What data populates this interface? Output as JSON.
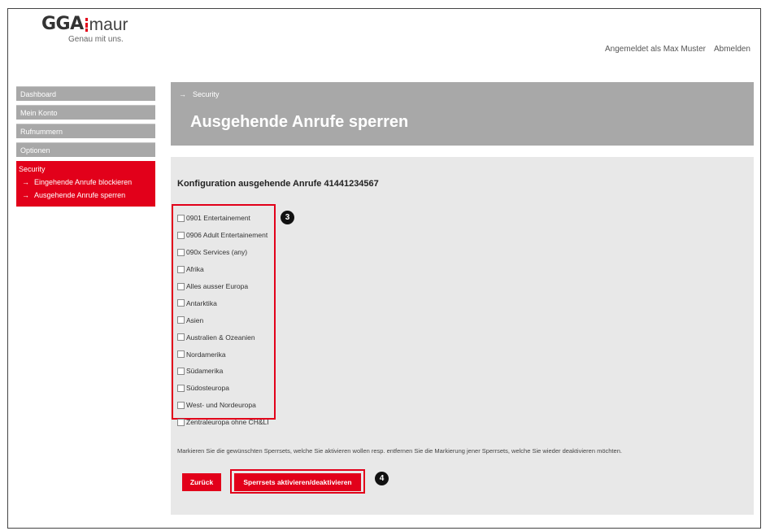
{
  "brand": {
    "logo_main": "GGA",
    "logo_sub": "maur",
    "tagline": "Genau mit uns."
  },
  "header": {
    "logged_in": "Angemeldet als Max Muster",
    "logout": "Abmelden"
  },
  "sidebar": {
    "items": [
      {
        "label": "Dashboard"
      },
      {
        "label": "Mein Konto"
      },
      {
        "label": "Rufnummern"
      },
      {
        "label": "Optionen"
      }
    ],
    "security": {
      "label": "Security",
      "subitems": [
        {
          "label": "Eingehende Anrufe blockieren"
        },
        {
          "label": "Ausgehende Anrufe sperren"
        }
      ]
    }
  },
  "main": {
    "breadcrumb": "Security",
    "title": "Ausgehende Anrufe sperren",
    "config_title": "Konfiguration ausgehende Anrufe 41441234567",
    "options": [
      {
        "label": "0901 Entertainement",
        "checked": false
      },
      {
        "label": "0906 Adult Entertainement",
        "checked": false
      },
      {
        "label": "090x Services (any)",
        "checked": false
      },
      {
        "label": "Afrika",
        "checked": false
      },
      {
        "label": "Alles ausser Europa",
        "checked": false
      },
      {
        "label": "Antarktika",
        "checked": false
      },
      {
        "label": "Asien",
        "checked": false
      },
      {
        "label": "Australien & Ozeanien",
        "checked": false
      },
      {
        "label": "Nordamerika",
        "checked": false
      },
      {
        "label": "Südamerika",
        "checked": false
      },
      {
        "label": "Südosteuropa",
        "checked": false
      },
      {
        "label": "West- und Nordeuropa",
        "checked": false
      },
      {
        "label": "Zentraleuropa ohne CH&LI",
        "checked": false
      }
    ],
    "hint": "Markieren Sie die gewünschten Sperrsets, welche Sie aktivieren wollen resp. entfernen Sie die Markierung jener Sperrsets, welche Sie wieder deaktivieren möchten.",
    "back_label": "Zurück",
    "toggle_label": "Sperrsets aktivieren/deaktivieren"
  },
  "annotations": {
    "badge_options": "3",
    "badge_button": "4"
  },
  "colors": {
    "brand_red": "#e2001a",
    "nav_gray": "#a8a8a8",
    "content_bg": "#e8e8e8"
  }
}
